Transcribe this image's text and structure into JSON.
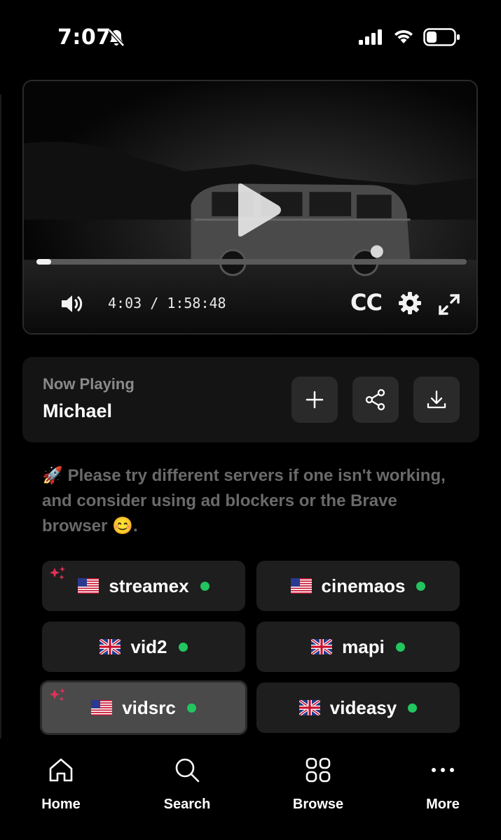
{
  "status_bar": {
    "time": "7:07"
  },
  "player": {
    "elapsed": "4:03",
    "separator": "/",
    "duration": "1:58:48",
    "progress_fraction": 0.034,
    "cc_label": "CC"
  },
  "now_playing": {
    "label": "Now Playing",
    "title": "Michael"
  },
  "notice": {
    "emoji_start": "🚀",
    "text": "Please try different servers if one isn't working, and consider using ad blockers or the Brave browser",
    "emoji_end": "😊",
    "end": "."
  },
  "servers": [
    {
      "name": "streamex",
      "flag": "us",
      "featured": true,
      "active": false
    },
    {
      "name": "cinemaos",
      "flag": "us",
      "featured": false,
      "active": false
    },
    {
      "name": "vid2",
      "flag": "uk",
      "featured": false,
      "active": false
    },
    {
      "name": "mapi",
      "flag": "uk",
      "featured": false,
      "active": false
    },
    {
      "name": "vidsrc",
      "flag": "us",
      "featured": true,
      "active": true
    },
    {
      "name": "videasy",
      "flag": "uk",
      "featured": false,
      "active": false
    }
  ],
  "tabs": [
    {
      "label": "Home",
      "icon": "home-icon"
    },
    {
      "label": "Search",
      "icon": "search-icon"
    },
    {
      "label": "Browse",
      "icon": "grid-icon"
    },
    {
      "label": "More",
      "icon": "more-icon"
    }
  ],
  "colors": {
    "online_dot": "#22c55e",
    "sparkle": "#e0315a"
  }
}
